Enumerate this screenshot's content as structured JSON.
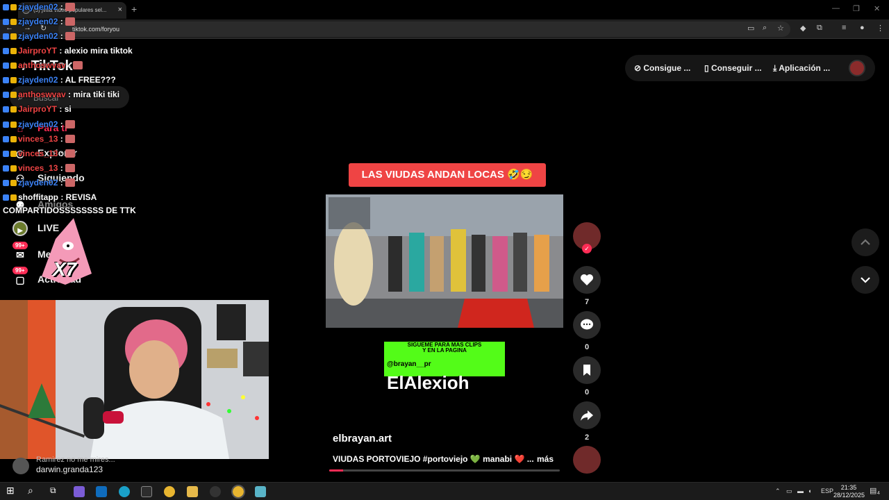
{
  "browser": {
    "tab_title": "(5) jvilla video populares sel...",
    "tab_close": "×",
    "new_tab": "+",
    "url": "tiktok.com/foryou"
  },
  "sidebar": {
    "logo": "TikTok",
    "search_placeholder": "Buscar",
    "items": [
      {
        "label": "Para ti",
        "icon": "home-icon"
      },
      {
        "label": "Explorar",
        "icon": "compass-icon"
      },
      {
        "label": "Siguiendo",
        "icon": "users-icon"
      },
      {
        "label": "Amigos",
        "icon": "friends-icon"
      },
      {
        "label": "LIVE",
        "icon": "live-icon"
      },
      {
        "label": "Mensajes",
        "icon": "message-icon",
        "badge": "99+"
      },
      {
        "label": "Actividad",
        "icon": "inbox-icon",
        "badge": "99+"
      }
    ]
  },
  "chat": [
    {
      "user": "zjayden02",
      "text": "",
      "color": "#3b82f6"
    },
    {
      "user": "zjayden02",
      "text": "",
      "color": "#3b82f6"
    },
    {
      "user": "zjayden02",
      "text": "",
      "color": "#3b82f6"
    },
    {
      "user": "JairproYT",
      "text": "alexio mira tiktok",
      "color": "#ef4444"
    },
    {
      "user": "anthoswvav",
      "text": "",
      "color": "#ef4444"
    },
    {
      "user": "zjayden02",
      "text": "AL FREE???",
      "color": "#3b82f6"
    },
    {
      "user": "anthoswvav",
      "text": "mira tiki tiki",
      "color": "#ef4444"
    },
    {
      "user": "JairproYT",
      "text": "si",
      "color": "#ef4444"
    },
    {
      "user": "zjayden02",
      "text": "",
      "color": "#3b82f6"
    },
    {
      "user": "vinces_13",
      "text": "",
      "color": "#ef4444"
    },
    {
      "user": "vinces_13",
      "text": "",
      "color": "#ef4444"
    },
    {
      "user": "vinces_13",
      "text": "",
      "color": "#ef4444"
    },
    {
      "user": "zjayden02",
      "text": "",
      "color": "#3b82f6"
    },
    {
      "user": "shoffitapp",
      "text": "REVISA",
      "color": "#ffffff"
    }
  ],
  "chat_wrap": "COMPARTIDOSSSSSSSS DE TTK",
  "overlay_multiplier": "X7",
  "comment": {
    "text": "Ramirez no me mires...",
    "user": "darwin.granda123"
  },
  "header": {
    "buttons": [
      {
        "label": "Consigue ...",
        "icon": "coin-icon"
      },
      {
        "label": "Conseguir ...",
        "icon": "phone-icon"
      },
      {
        "label": "Aplicación ...",
        "icon": "download-icon"
      }
    ]
  },
  "video": {
    "caption_banner": "LAS VIUDAS ANDAN LOCAS 🤣😏",
    "kick_tag_line1": "SIGUEME PARA MAS CLIPS",
    "kick_tag_line2": "Y EN LA PAGINA",
    "kick_handle": "@brayan__pr",
    "kick_name": "ElAlexioh",
    "author": "elbrayan.art",
    "description": "VIUDAS PORTOVIEJO #portoviejo 💚 manabi ❤️ ...",
    "more": "más",
    "progress": 0.06
  },
  "actions": {
    "likes": "7",
    "comments": "0",
    "saves": "0",
    "shares": "2"
  },
  "taskbar": {
    "lang": "ESP",
    "time": "21:35",
    "date": "28/12/2025",
    "notifications": "4"
  },
  "colors": {
    "accent": "#fe2c55",
    "kick_green": "#53fc18",
    "banner_red": "#ef4444"
  }
}
